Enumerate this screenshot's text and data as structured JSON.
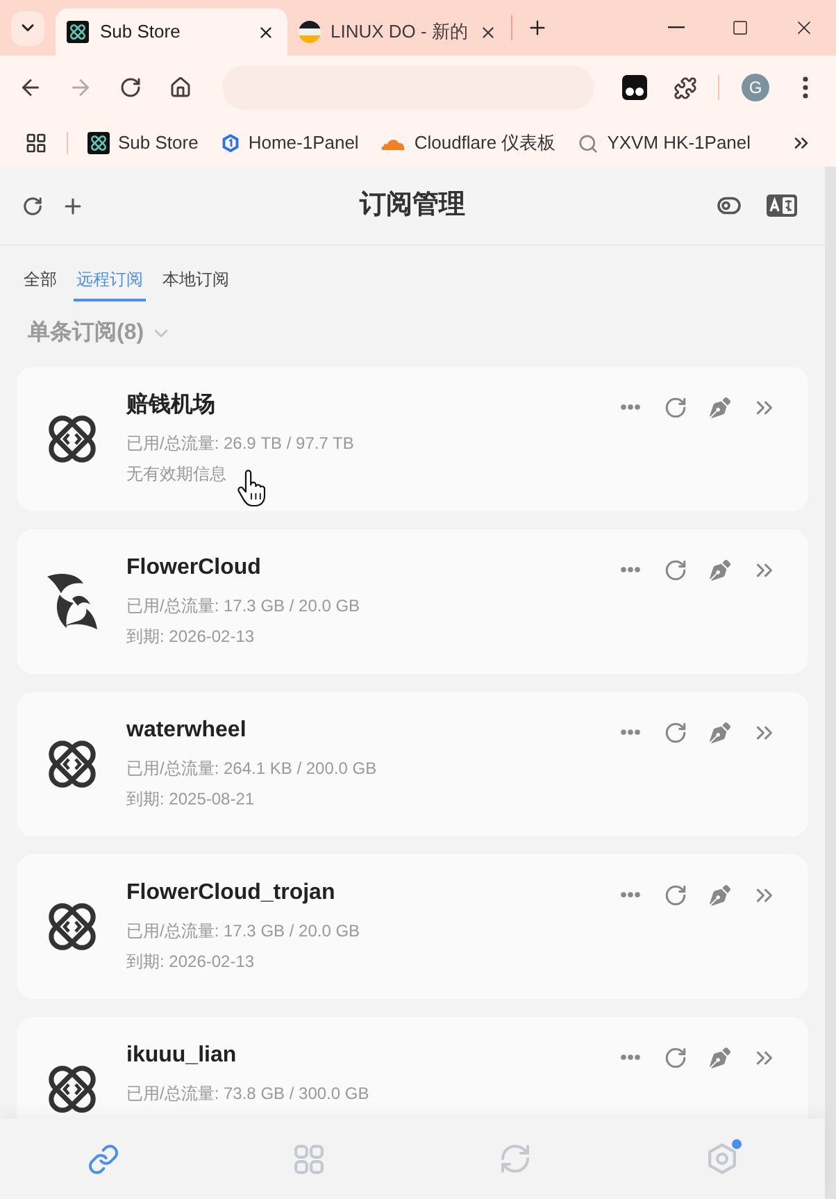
{
  "browser": {
    "tabs": [
      {
        "title": "Sub Store",
        "kind": "substore",
        "selected": true
      },
      {
        "title": "LINUX DO - 新的",
        "kind": "linuxdo",
        "selected": false
      }
    ],
    "profile_initial": "G",
    "bookmarks": [
      {
        "label": "Sub Store",
        "kind": "substore"
      },
      {
        "label": "Home-1Panel",
        "kind": "panel"
      },
      {
        "label": "Cloudflare 仪表板",
        "kind": "cloudflare"
      },
      {
        "label": "YXVM HK-1Panel",
        "kind": "search"
      }
    ]
  },
  "header": {
    "title": "订阅管理"
  },
  "tabs": [
    {
      "label": "全部",
      "selected": false
    },
    {
      "label": "远程订阅",
      "selected": true
    },
    {
      "label": "本地订阅",
      "selected": false
    }
  ],
  "group": {
    "label": "单条订阅(8)"
  },
  "subscriptions": [
    {
      "name": "赔钱机场",
      "kind": "links",
      "usage": "已用/总流量: 26.9 TB / 97.7 TB",
      "expiry": "无有效期信息"
    },
    {
      "name": "FlowerCloud",
      "kind": "petal",
      "usage": "已用/总流量: 17.3 GB / 20.0 GB",
      "expiry": "到期: 2026-02-13"
    },
    {
      "name": "waterwheel",
      "kind": "links",
      "usage": "已用/总流量: 264.1 KB / 200.0 GB",
      "expiry": "到期: 2025-08-21"
    },
    {
      "name": "FlowerCloud_trojan",
      "kind": "links",
      "usage": "已用/总流量: 17.3 GB / 20.0 GB",
      "expiry": "到期: 2026-02-13"
    },
    {
      "name": "ikuuu_lian",
      "kind": "links",
      "usage": "已用/总流量: 73.8 GB / 300.0 GB"
    }
  ],
  "bottom_nav": [
    {
      "kind": "link",
      "selected": true,
      "badge": false
    },
    {
      "kind": "grid",
      "selected": false,
      "badge": false
    },
    {
      "kind": "sync",
      "selected": false,
      "badge": false
    },
    {
      "kind": "settings",
      "selected": false,
      "badge": true
    }
  ]
}
